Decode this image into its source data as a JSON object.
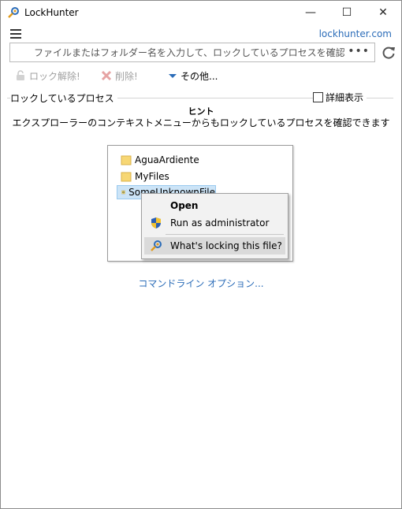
{
  "window": {
    "title": "LockHunter",
    "controls": {
      "minimize": "—",
      "maximize": "☐",
      "close": "✕"
    }
  },
  "header": {
    "site_link": "lockhunter.com"
  },
  "search": {
    "placeholder": "ファイルまたはフォルダー名を入力して、ロックしているプロセスを確認",
    "browse_label": "•••"
  },
  "toolbar": {
    "unlock_label": "ロック解除!",
    "delete_label": "削除!",
    "other_label": "その他..."
  },
  "process_section": {
    "label": "ロックしているプロセス",
    "detail_label": "詳細表示",
    "detail_checked": false
  },
  "hint": {
    "title": "ヒント",
    "text": "エクスプローラーのコンテキストメニューからもロックしているプロセスを確認できます"
  },
  "illustration": {
    "files": [
      "AguaArdiente",
      "MyFiles",
      "SomeUnknownFile"
    ],
    "context_menu": {
      "open": "Open",
      "run_admin": "Run as administrator",
      "locking": "What's locking this file?"
    }
  },
  "footer": {
    "command_line_link": "コマンドライン オプション..."
  },
  "colors": {
    "link": "#2b6cb8",
    "selection": "#cce4f7",
    "menu_bg": "#f2f2f2"
  }
}
